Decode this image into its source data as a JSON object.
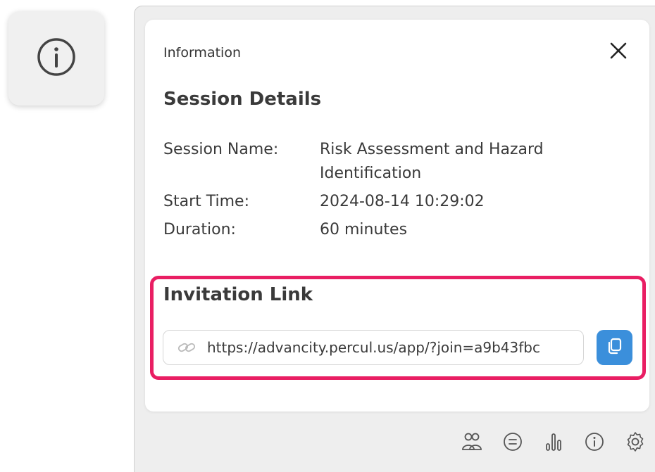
{
  "panel": {
    "header_label": "Information"
  },
  "session": {
    "title": "Session Details",
    "fields": [
      {
        "label": "Session Name:",
        "value": "Risk Assessment and Hazard Identification"
      },
      {
        "label": "Start Time:",
        "value": "2024-08-14 10:29:02"
      },
      {
        "label": "Duration:",
        "value": "60 minutes"
      }
    ]
  },
  "invitation": {
    "title": "Invitation Link",
    "url": "https://advancity.percul.us/app/?join=a9b43fbc"
  },
  "colors": {
    "highlight": "#e91e63",
    "copy_button": "#3b8fdb"
  },
  "toolbar": {
    "icons": [
      "participants-icon",
      "chat-icon",
      "stats-icon",
      "info-icon",
      "settings-icon"
    ]
  }
}
